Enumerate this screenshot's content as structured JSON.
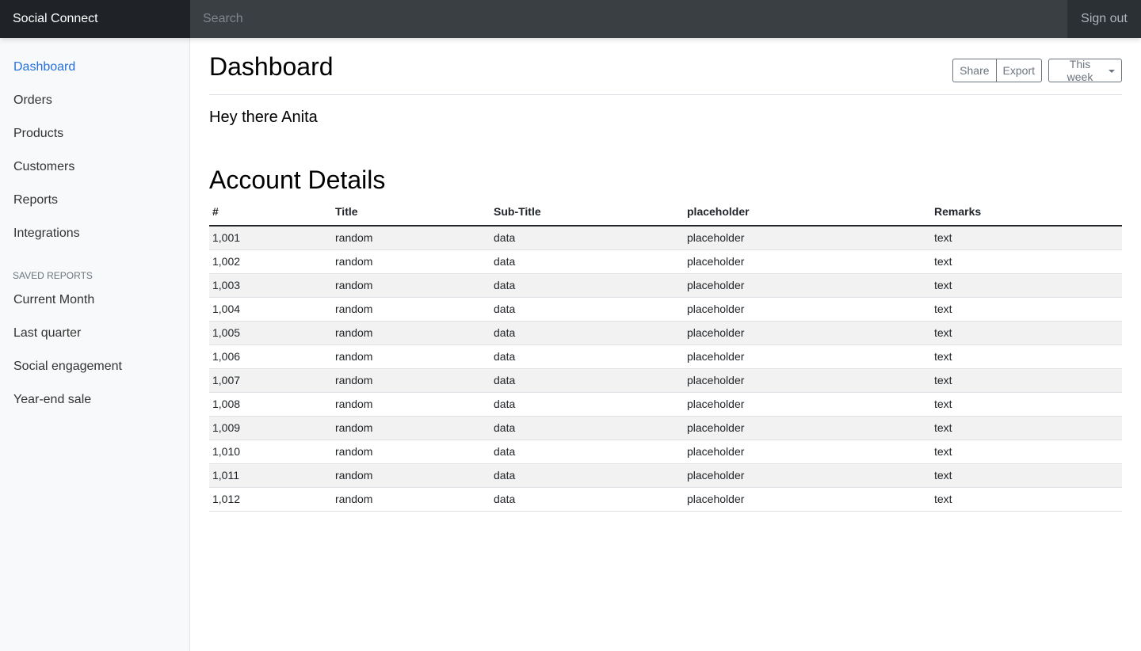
{
  "topbar": {
    "brand": "Social Connect",
    "search_placeholder": "Search",
    "signout_label": "Sign out"
  },
  "sidebar": {
    "items": [
      {
        "label": "Dashboard"
      },
      {
        "label": "Orders"
      },
      {
        "label": "Products"
      },
      {
        "label": "Customers"
      },
      {
        "label": "Reports"
      },
      {
        "label": "Integrations"
      }
    ],
    "saved_heading": "Saved reports",
    "saved_items": [
      {
        "label": "Current Month"
      },
      {
        "label": "Last quarter"
      },
      {
        "label": "Social engagement"
      },
      {
        "label": "Year-end sale"
      }
    ]
  },
  "main": {
    "title": "Dashboard",
    "share_label": "Share",
    "export_label": "Export",
    "period_label": "This week",
    "greeting": "Hey there Anita",
    "section_title": "Account Details",
    "table": {
      "headers": [
        "#",
        "Title",
        "Sub-Title",
        "placeholder",
        "Remarks"
      ],
      "rows": [
        [
          "1,001",
          "random",
          "data",
          "placeholder",
          "text"
        ],
        [
          "1,002",
          "random",
          "data",
          "placeholder",
          "text"
        ],
        [
          "1,003",
          "random",
          "data",
          "placeholder",
          "text"
        ],
        [
          "1,004",
          "random",
          "data",
          "placeholder",
          "text"
        ],
        [
          "1,005",
          "random",
          "data",
          "placeholder",
          "text"
        ],
        [
          "1,006",
          "random",
          "data",
          "placeholder",
          "text"
        ],
        [
          "1,007",
          "random",
          "data",
          "placeholder",
          "text"
        ],
        [
          "1,008",
          "random",
          "data",
          "placeholder",
          "text"
        ],
        [
          "1,009",
          "random",
          "data",
          "placeholder",
          "text"
        ],
        [
          "1,010",
          "random",
          "data",
          "placeholder",
          "text"
        ],
        [
          "1,011",
          "random",
          "data",
          "placeholder",
          "text"
        ],
        [
          "1,012",
          "random",
          "data",
          "placeholder",
          "text"
        ]
      ]
    }
  },
  "colors": {
    "topbar": "#343a40",
    "brand_bg": "#1f2327",
    "active_link": "#2470dc",
    "sidebar_bg": "#f8f9fa"
  }
}
